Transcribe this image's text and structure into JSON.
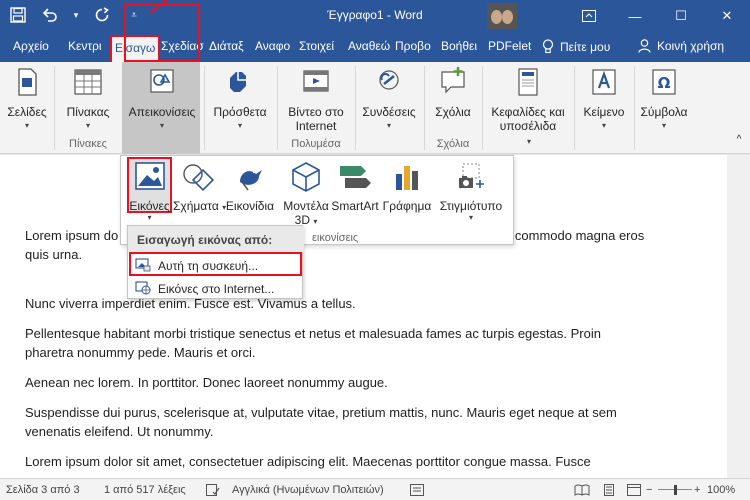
{
  "window": {
    "title": "Έγγραφο1 - Word",
    "minimize": "—",
    "maximize": "☐",
    "close": "✕"
  },
  "tabs": [
    {
      "label": "Αρχείο"
    },
    {
      "label": "Κεντρι"
    },
    {
      "label": "Εισαγω"
    },
    {
      "label": "Σχεδίασ"
    },
    {
      "label": "Διάταξ"
    },
    {
      "label": "Αναφο"
    },
    {
      "label": "Στοιχεί"
    },
    {
      "label": "Αναθεώ"
    },
    {
      "label": "Προβο"
    },
    {
      "label": "Βοήθει"
    },
    {
      "label": "PDFelet"
    }
  ],
  "tell_me": "Πείτε μου",
  "share": "Κοινή χρήση",
  "ribbon": {
    "pages": "Σελίδες",
    "table": "Πίνακας",
    "tables_group": "Πίνακες",
    "illustrations": "Απεικονίσεις",
    "addins": "Πρόσθετα",
    "video_line1": "Βίντεο στο",
    "video_line2": "Internet",
    "media_group": "Πολυμέσα",
    "links": "Συνδέσεις",
    "comment": "Σχόλια",
    "comments_group": "Σχόλια",
    "header_line1": "Κεφαλίδες και",
    "header_line2": "υποσέλιδα",
    "text": "Κείμενο",
    "symbols": "Σύμβολα"
  },
  "gallery": {
    "pictures": "Εικόνες",
    "shapes": "Σχήματα",
    "icons": "Εικονίδια",
    "models_line1": "Μοντέλα",
    "models_line2": "3D",
    "smartart": "SmartArt",
    "chart": "Γράφημα",
    "screenshot": "Στιγμιότυπο",
    "group_label": "εικονίσεις"
  },
  "submenu": {
    "header": "Εισαγωγή εικόνας από:",
    "this_device": "Αυτή τη συσκευή...",
    "online": "Εικόνες στο Internet..."
  },
  "document": {
    "paragraphs": [
      "Lorem ipsum do                                                                           ue massa. Fusce posuere, magna s                               ctus malesuada libero, sit amet commodo magna eros quis urna.",
      "Nunc viverra imperdiet enim. Fusce est. Vivamus a tellus.",
      "Pellentesque habitant morbi tristique senectus et netus et malesuada fames ac turpis egestas. Proin pharetra nonummy pede. Mauris et orci.",
      "Aenean nec lorem. In porttitor. Donec laoreet nonummy augue.",
      "Suspendisse dui purus, scelerisque at, vulputate vitae, pretium mattis, nunc. Mauris eget neque at sem venenatis eleifend. Ut nonummy.",
      "Lorem ipsum dolor sit amet, consectetuer adipiscing elit. Maecenas porttitor congue massa. Fusce"
    ]
  },
  "status": {
    "page": "Σελίδα 3 από 3",
    "words": "1 από 517 λέξεις",
    "language": "Αγγλικά (Ηνωμένων Πολιτειών)",
    "zoom": "100%",
    "minus": "−",
    "plus": "+"
  },
  "colors": {
    "accent": "#2b579a",
    "highlight": "#e81123"
  }
}
